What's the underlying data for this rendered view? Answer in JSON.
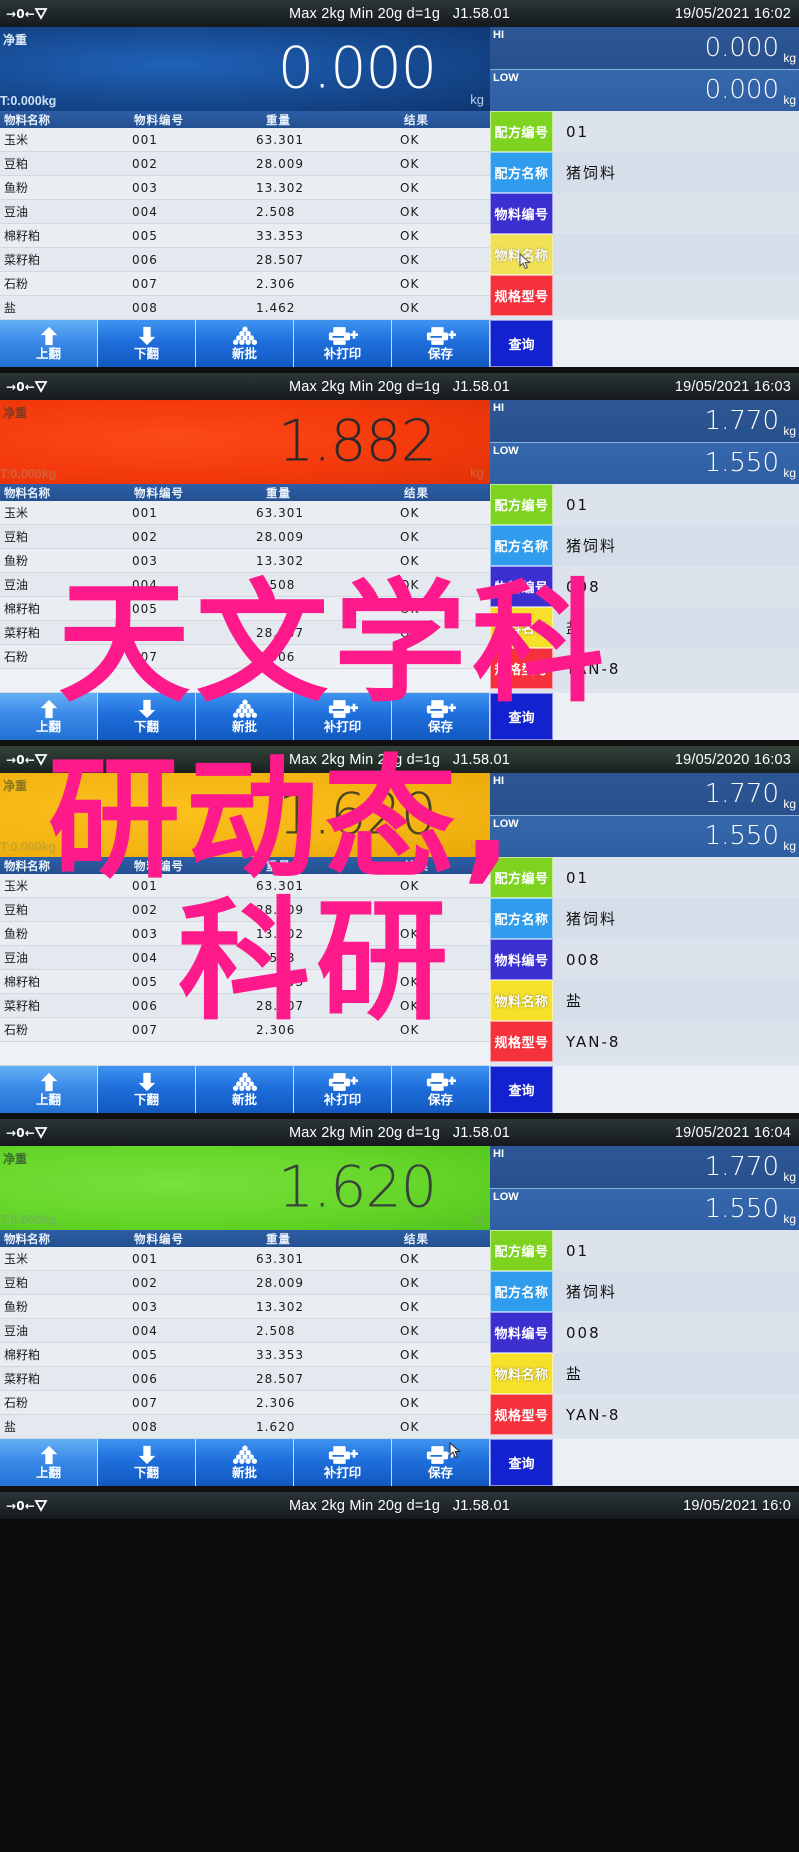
{
  "device": {
    "status_bar": {
      "zero_icon": "zero-indicator-icon",
      "stable_icon": "stability-icon",
      "spec": "Max 2kg  Min 20g  d=1g",
      "version": "J1.58.01"
    },
    "labels": {
      "net_weight": "净重",
      "tare": "T:0.000kg",
      "unit": "kg",
      "hi": "HI",
      "low": "LOW"
    },
    "table_headers": {
      "name": "物料名称",
      "code": "物料编号",
      "weight": "重量",
      "result": "结果"
    },
    "field_labels": {
      "formula_code": "配方编号",
      "formula_name": "配方名称",
      "material_code": "物料编号",
      "material_name": "物料名称",
      "spec_model": "规格型号"
    },
    "field_colors": {
      "formula_code": "#7ed321",
      "formula_name": "#2f9ced",
      "material_code": "#3b2fd0",
      "material_name": "#f5e02a",
      "spec_model": "#f5323c"
    },
    "toolbar": {
      "page_up": "上翻",
      "page_down": "下翻",
      "new_batch": "新批",
      "reprint": "补打印",
      "save": "保存",
      "query": "查询"
    }
  },
  "panels": [
    {
      "id": "panel-1",
      "datetime": "19/05/2021  16:02",
      "weight": "0.000",
      "weight_bg": "blue",
      "tare": "T:0.000kg",
      "hi": "0.000",
      "low": "0.000",
      "rows": [
        {
          "name": "玉米",
          "code": "001",
          "weight": "63.301",
          "result": "OK"
        },
        {
          "name": "豆粕",
          "code": "002",
          "weight": "28.009",
          "result": "OK"
        },
        {
          "name": "鱼粉",
          "code": "003",
          "weight": "13.302",
          "result": "OK"
        },
        {
          "name": "豆油",
          "code": "004",
          "weight": "2.508",
          "result": "OK"
        },
        {
          "name": "棉籽粕",
          "code": "005",
          "weight": "33.353",
          "result": "OK"
        },
        {
          "name": "菜籽粕",
          "code": "006",
          "weight": "28.507",
          "result": "OK"
        },
        {
          "name": "石粉",
          "code": "007",
          "weight": "2.306",
          "result": "OK"
        },
        {
          "name": "盐",
          "code": "008",
          "weight": "1.462",
          "result": "OK"
        }
      ],
      "fields": {
        "formula_code": "01",
        "formula_name": "猪饲料",
        "material_code": "",
        "material_name": "",
        "spec_model": ""
      },
      "cursor_on": "material-name-button"
    },
    {
      "id": "panel-2",
      "datetime": "19/05/2021  16:03",
      "weight": "1.882",
      "weight_bg": "red",
      "tare": "T:0.000kg",
      "hi": "1.770",
      "low": "1.550",
      "rows": [
        {
          "name": "玉米",
          "code": "001",
          "weight": "63.301",
          "result": "OK"
        },
        {
          "name": "豆粕",
          "code": "002",
          "weight": "28.009",
          "result": "OK"
        },
        {
          "name": "鱼粉",
          "code": "003",
          "weight": "13.302",
          "result": "OK"
        },
        {
          "name": "豆油",
          "code": "004",
          "weight": "2.508",
          "result": "OK"
        },
        {
          "name": "棉籽粕",
          "code": "005",
          "weight": "33.353",
          "result": "OK"
        },
        {
          "name": "菜籽粕",
          "code": "006",
          "weight": "28.507",
          "result": "OK"
        },
        {
          "name": "石粉",
          "code": "007",
          "weight": "2.306",
          "result": "OK"
        }
      ],
      "fields": {
        "formula_code": "01",
        "formula_name": "猪饲料",
        "material_code": "008",
        "material_name": "盐",
        "spec_model": "YAN-8"
      },
      "cursor_on": ""
    },
    {
      "id": "panel-3",
      "datetime": "19/05/2020  16:03",
      "weight": "1.620",
      "weight_bg": "yellow",
      "tare": "T:0.000kg",
      "hi": "1.770",
      "low": "1.550",
      "rows": [
        {
          "name": "玉米",
          "code": "001",
          "weight": "63.301",
          "result": "OK"
        },
        {
          "name": "豆粕",
          "code": "002",
          "weight": "28.009",
          "result": "OK"
        },
        {
          "name": "鱼粉",
          "code": "003",
          "weight": "13.302",
          "result": "OK"
        },
        {
          "name": "豆油",
          "code": "004",
          "weight": "2.508",
          "result": "OK"
        },
        {
          "name": "棉籽粕",
          "code": "005",
          "weight": "33.353",
          "result": "OK"
        },
        {
          "name": "菜籽粕",
          "code": "006",
          "weight": "28.507",
          "result": "OK"
        },
        {
          "name": "石粉",
          "code": "007",
          "weight": "2.306",
          "result": "OK"
        }
      ],
      "fields": {
        "formula_code": "01",
        "formula_name": "猪饲料",
        "material_code": "008",
        "material_name": "盐",
        "spec_model": "YAN-8"
      },
      "cursor_on": ""
    },
    {
      "id": "panel-4",
      "datetime": "19/05/2021  16:04",
      "weight": "1.620",
      "weight_bg": "green",
      "tare": "T:0.000kg",
      "hi": "1.770",
      "low": "1.550",
      "rows": [
        {
          "name": "玉米",
          "code": "001",
          "weight": "63.301",
          "result": "OK"
        },
        {
          "name": "豆粕",
          "code": "002",
          "weight": "28.009",
          "result": "OK"
        },
        {
          "name": "鱼粉",
          "code": "003",
          "weight": "13.302",
          "result": "OK"
        },
        {
          "name": "豆油",
          "code": "004",
          "weight": "2.508",
          "result": "OK"
        },
        {
          "name": "棉籽粕",
          "code": "005",
          "weight": "33.353",
          "result": "OK"
        },
        {
          "name": "菜籽粕",
          "code": "006",
          "weight": "28.507",
          "result": "OK"
        },
        {
          "name": "石粉",
          "code": "007",
          "weight": "2.306",
          "result": "OK"
        },
        {
          "name": "盐",
          "code": "008",
          "weight": "1.620",
          "result": "OK"
        }
      ],
      "fields": {
        "formula_code": "01",
        "formula_name": "猪饲料",
        "material_code": "008",
        "material_name": "盐",
        "spec_model": "YAN-8"
      },
      "cursor_on": "save-button"
    },
    {
      "id": "panel-5",
      "datetime": "19/05/2021  16:0",
      "weight": "",
      "weight_bg": "blue",
      "tare": "",
      "hi": "",
      "low": "",
      "rows": [],
      "fields": {},
      "cursor_on": ""
    }
  ],
  "watermark": {
    "line1": "天文学科",
    "line2": "研动态,",
    "line3": "科研",
    "color": "#ff1a8c"
  }
}
